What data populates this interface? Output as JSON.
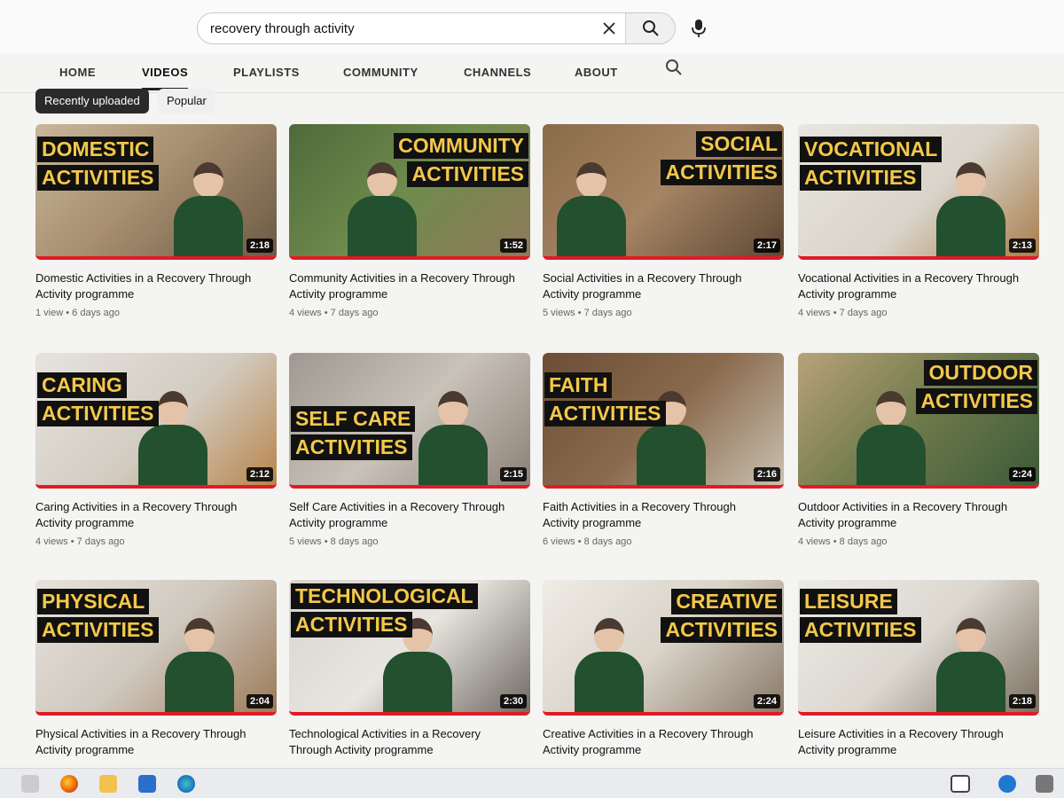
{
  "search": {
    "query": "recovery through activity"
  },
  "tabs": [
    "HOME",
    "VIDEOS",
    "PLAYLISTS",
    "COMMUNITY",
    "CHANNELS",
    "ABOUT"
  ],
  "chips": [
    "Recently uploaded",
    "Popular"
  ],
  "videos": [
    {
      "label": [
        "DOMESTIC",
        "ACTIVITIES"
      ],
      "duration": "2:18",
      "title": "Domestic Activities in a Recovery Through Activity programme",
      "views": "1 view",
      "age": "6 days ago"
    },
    {
      "label": [
        "COMMUNITY",
        "ACTIVITIES"
      ],
      "duration": "1:52",
      "title": "Community Activities in a Recovery Through Activity programme",
      "views": "4 views",
      "age": "7 days ago"
    },
    {
      "label": [
        "SOCIAL",
        "ACTIVITIES"
      ],
      "duration": "2:17",
      "title": "Social Activities in a Recovery Through Activity programme",
      "views": "5 views",
      "age": "7 days ago"
    },
    {
      "label": [
        "VOCATIONAL",
        "ACTIVITIES"
      ],
      "duration": "2:13",
      "title": "Vocational Activities in a Recovery Through Activity programme",
      "views": "4 views",
      "age": "7 days ago"
    },
    {
      "label": [
        "CARING",
        "ACTIVITIES"
      ],
      "duration": "2:12",
      "title": "Caring Activities in a Recovery Through Activity programme",
      "views": "4 views",
      "age": "7 days ago"
    },
    {
      "label": [
        "SELF CARE",
        "ACTIVITIES"
      ],
      "duration": "2:15",
      "title": "Self Care Activities in a Recovery Through Activity programme",
      "views": "5 views",
      "age": "8 days ago"
    },
    {
      "label": [
        "FAITH",
        "ACTIVITIES"
      ],
      "duration": "2:16",
      "title": "Faith Activities in a Recovery Through Activity programme",
      "views": "6 views",
      "age": "8 days ago"
    },
    {
      "label": [
        "OUTDOOR",
        "ACTIVITIES"
      ],
      "duration": "2:24",
      "title": "Outdoor Activities in a Recovery Through Activity programme",
      "views": "4 views",
      "age": "8 days ago"
    },
    {
      "label": [
        "PHYSICAL",
        "ACTIVITIES"
      ],
      "duration": "2:04",
      "title": "Physical Activities in a Recovery Through Activity programme",
      "views": "",
      "age": ""
    },
    {
      "label": [
        "TECHNOLOGICAL",
        "ACTIVITIES"
      ],
      "duration": "2:30",
      "title": "Technological Activities in a Recovery Through Activity programme",
      "views": "",
      "age": ""
    },
    {
      "label": [
        "CREATIVE",
        "ACTIVITIES"
      ],
      "duration": "2:24",
      "title": "Creative Activities in a Recovery Through Activity programme",
      "views": "",
      "age": ""
    },
    {
      "label": [
        "LEISURE",
        "ACTIVITIES"
      ],
      "duration": "2:18",
      "title": "Leisure Activities in a Recovery Through Activity programme",
      "views": "",
      "age": ""
    }
  ],
  "taskbar": {
    "icons": [
      "task-view-icon",
      "firefox-icon",
      "file-explorer-icon",
      "mail-icon",
      "edge-icon",
      "news-widget-icon",
      "onedrive-icon",
      "network-icon"
    ]
  },
  "colors": {
    "accent": "#e01b24",
    "label_text": "#f3c84a",
    "label_bg": "#111111"
  }
}
